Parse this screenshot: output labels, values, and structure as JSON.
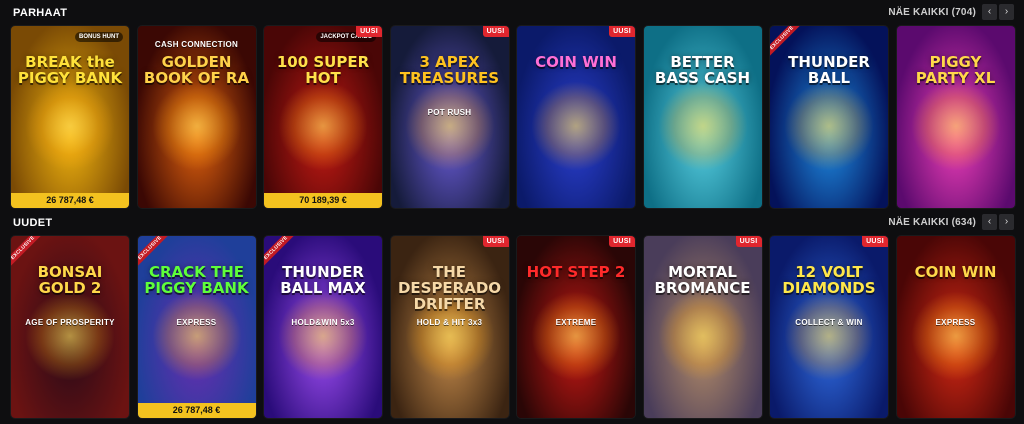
{
  "sections": [
    {
      "id": "parhaat",
      "title": "PARHAAT",
      "see_all": "NÄE KAIKKI (704)",
      "tiles": [
        {
          "title": "BREAK the PIGGY BANK",
          "sub": "",
          "jackpot": "26 787,48 €",
          "badge_new": "",
          "exclusive": "",
          "brand": "BONUS HUNT",
          "bg": "#7a4a05",
          "bg2": "#f2b50f",
          "title_color": "#ffe23a",
          "art": "piggy"
        },
        {
          "title": "GOLDEN BOOK OF RA",
          "sub": "CASH CONNECTION",
          "jackpot": "",
          "badge_new": "",
          "exclusive": "",
          "brand": "",
          "bg": "#3b0804",
          "bg2": "#e4640e",
          "title_color": "#ffd24a",
          "art": "book"
        },
        {
          "title": "100 SUPER HOT",
          "sub": "",
          "jackpot": "70 189,39 €",
          "badge_new": "UUSI",
          "exclusive": "",
          "brand": "JACKPOT CARDS",
          "bg": "#4a0606",
          "bg2": "#c41a14",
          "title_color": "#ffe14a",
          "art": "seven"
        },
        {
          "title": "3 APEX TREASURES",
          "sub": "POT RUSH",
          "jackpot": "",
          "badge_new": "UUSI",
          "exclusive": "",
          "brand": "",
          "bg": "#151b3a",
          "bg2": "#6a5cd8",
          "title_color": "#ffc21f",
          "art": "wolf"
        },
        {
          "title": "COIN WIN",
          "sub": "",
          "jackpot": "",
          "badge_new": "UUSI",
          "exclusive": "",
          "brand": "",
          "bg": "#0b1a6a",
          "bg2": "#2a3fd0",
          "title_color": "#ff6fd6",
          "art": "coin"
        },
        {
          "title": "BETTER BASS CASH",
          "sub": "",
          "jackpot": "",
          "badge_new": "",
          "exclusive": "",
          "brand": "",
          "bg": "#0e6f86",
          "bg2": "#58d0e2",
          "title_color": "#ffffff",
          "art": "fisher"
        },
        {
          "title": "THUNDER BALL",
          "sub": "",
          "jackpot": "",
          "badge_new": "",
          "exclusive": "EXCLUSIVE",
          "brand": "",
          "bg": "#04125a",
          "bg2": "#1f8fe6",
          "title_color": "#ffffff",
          "art": "ball"
        },
        {
          "title": "PIGGY PARTY XL",
          "sub": "",
          "jackpot": "",
          "badge_new": "",
          "exclusive": "",
          "brand": "",
          "bg": "#5b0a6e",
          "bg2": "#f03fb8",
          "title_color": "#ffd84a",
          "art": "pig"
        }
      ]
    },
    {
      "id": "uudet",
      "title": "UUDET",
      "see_all": "NÄE KAIKKI (634)",
      "tiles": [
        {
          "title": "BONSAI GOLD 2",
          "sub": "AGE OF PROSPERITY",
          "jackpot": "",
          "badge_new": "",
          "exclusive": "EXCLUSIVE",
          "brand": "",
          "bg": "#6b1312",
          "bg2": "#2a0a18",
          "title_color": "#ffd84a",
          "art": "bonsai"
        },
        {
          "title": "CRACK THE PIGGY BANK",
          "sub": "EXPRESS",
          "jackpot": "26 787,48 €",
          "badge_new": "",
          "exclusive": "EXCLUSIVE",
          "brand": "",
          "bg": "#1f3f9a",
          "bg2": "#6a2db0",
          "title_color": "#5eff3a",
          "art": "gang"
        },
        {
          "title": "THUNDER BALL MAX",
          "sub": "HOLD&WIN 5x3",
          "jackpot": "",
          "badge_new": "",
          "exclusive": "EXCLUSIVE",
          "brand": "",
          "bg": "#2a0c7a",
          "bg2": "#9d4cf0",
          "title_color": "#ffffff",
          "art": "maxball"
        },
        {
          "title": "THE DESPERADO DRIFTER",
          "sub": "HOLD & HIT 3x3",
          "jackpot": "",
          "badge_new": "UUSI",
          "exclusive": "",
          "brand": "",
          "bg": "#3b2412",
          "bg2": "#c48a4a",
          "title_color": "#f6d9a8",
          "art": "train"
        },
        {
          "title": "HOT STEP 2",
          "sub": "EXTREME",
          "jackpot": "",
          "badge_new": "UUSI",
          "exclusive": "",
          "brand": "",
          "bg": "#2a0606",
          "bg2": "#c41814",
          "title_color": "#ff2a2a",
          "art": "crown"
        },
        {
          "title": "MORTAL BROMANCE",
          "sub": "",
          "jackpot": "",
          "badge_new": "UUSI",
          "exclusive": "",
          "brand": "",
          "bg": "#4a3d5a",
          "bg2": "#b48c68",
          "title_color": "#ffffff",
          "art": "man"
        },
        {
          "title": "12 VOLT DIAMONDS",
          "sub": "COLLECT & WIN",
          "jackpot": "",
          "badge_new": "UUSI",
          "exclusive": "",
          "brand": "",
          "bg": "#0a1a6a",
          "bg2": "#2f6be0",
          "title_color": "#ffe74a",
          "art": "diamond"
        },
        {
          "title": "COIN WIN",
          "sub": "EXPRESS",
          "jackpot": "",
          "badge_new": "",
          "exclusive": "",
          "brand": "",
          "bg": "#4a0606",
          "bg2": "#d42814",
          "title_color": "#ffd84a",
          "art": "coinexpress"
        }
      ]
    }
  ],
  "nav": {
    "prev_label": "‹",
    "next_label": "›"
  }
}
